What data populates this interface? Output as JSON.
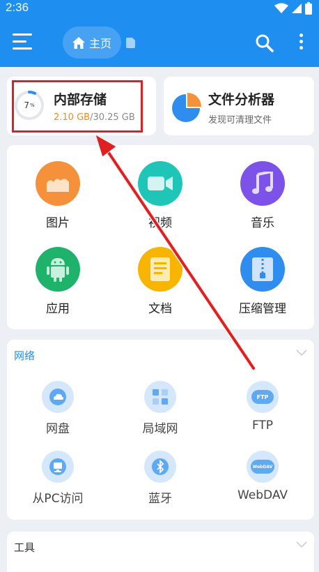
{
  "status": {
    "time": "2:36"
  },
  "header": {
    "home_label": "主页"
  },
  "storage": {
    "title": "内部存储",
    "percent": "7",
    "percent_unit": "%",
    "used": "2.10 GB",
    "total": "/30.25 GB",
    "used_fraction": 0.07
  },
  "analyzer": {
    "title": "文件分析器",
    "subtitle": "发现可清理文件"
  },
  "categories": [
    {
      "label": "图片",
      "icon": "picture-icon",
      "color": "#f5913a"
    },
    {
      "label": "视频",
      "icon": "video-icon",
      "color": "#1fc6b7"
    },
    {
      "label": "音乐",
      "icon": "music-icon",
      "color": "#7c52e8"
    },
    {
      "label": "应用",
      "icon": "android-icon",
      "color": "#1fb26b"
    },
    {
      "label": "文档",
      "icon": "document-icon",
      "color": "#f7b500"
    },
    {
      "label": "压缩管理",
      "icon": "archive-icon",
      "color": "#2f8df0"
    }
  ],
  "network": {
    "title": "网络",
    "items": [
      {
        "label": "网盘",
        "icon": "cloud-icon"
      },
      {
        "label": "局域网",
        "icon": "lan-icon"
      },
      {
        "label": "FTP",
        "icon": "ftp-icon",
        "badge": "FTP"
      },
      {
        "label": "从PC访问",
        "icon": "pc-icon"
      },
      {
        "label": "蓝牙",
        "icon": "bluetooth-icon"
      },
      {
        "label": "WebDAV",
        "icon": "webdav-icon",
        "badge": "WebDAV"
      }
    ]
  },
  "tools": {
    "title": "工具"
  },
  "colors": {
    "primary": "#1f8ef1",
    "accent_orange": "#f28b1e",
    "highlight_red": "#e02020",
    "net_icon_bg": "#d5e8fb"
  }
}
